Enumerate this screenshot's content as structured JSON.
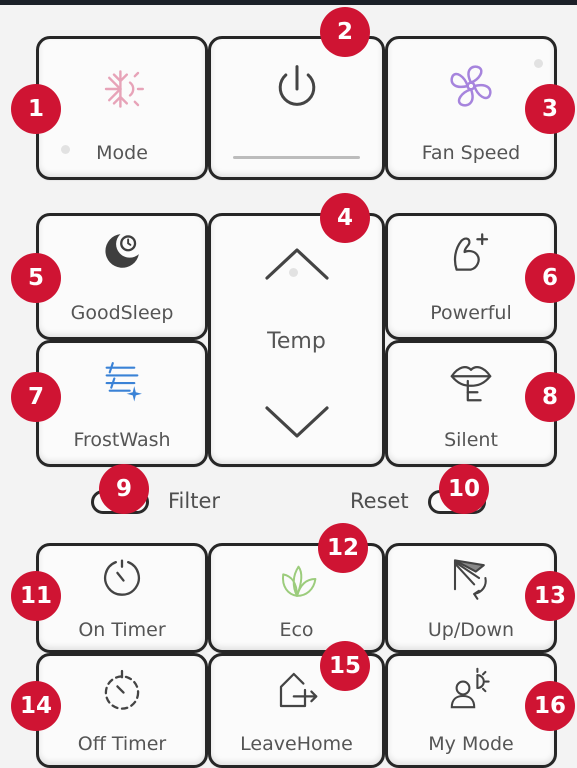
{
  "colors": {
    "badge": "#cf1433",
    "mode_icon": "#e7a3b8",
    "fan_icon": "#a684dd",
    "frostwash_icon": "#3a82d6",
    "eco_icon": "#9ccc7c",
    "outline": "#262626",
    "label_text": "#555555"
  },
  "buttons": {
    "mode": {
      "label": "Mode",
      "icon": "snowflake-sun-icon",
      "badge": "1"
    },
    "power": {
      "icon": "power-icon",
      "badge": "2"
    },
    "fan_speed": {
      "label": "Fan Speed",
      "icon": "fan-icon",
      "badge": "3"
    },
    "temp": {
      "label": "Temp",
      "icon_up": "chevron-up-icon",
      "icon_down": "chevron-down-icon",
      "badge": "4"
    },
    "good_sleep": {
      "label": "GoodSleep",
      "icon": "moon-icon",
      "badge": "5"
    },
    "powerful": {
      "label": "Powerful",
      "icon": "flexed-arm-icon",
      "badge": "6"
    },
    "frost_wash": {
      "label": "FrostWash",
      "icon": "frost-wash-icon",
      "badge": "7"
    },
    "silent": {
      "label": "Silent",
      "icon": "lips-icon",
      "badge": "8"
    },
    "on_timer": {
      "label": "On Timer",
      "icon": "timer-icon",
      "badge": "11"
    },
    "eco": {
      "label": "Eco",
      "icon": "leaves-icon",
      "badge": "12"
    },
    "up_down": {
      "label": "Up/Down",
      "icon": "swing-icon",
      "badge": "13"
    },
    "off_timer": {
      "label": "Off Timer",
      "icon": "dashed-timer-icon",
      "badge": "14"
    },
    "leave_home": {
      "label": "LeaveHome",
      "icon": "leave-home-icon",
      "badge": "15"
    },
    "my_mode": {
      "label": "My Mode",
      "icon": "person-sun-icon",
      "badge": "16"
    }
  },
  "filter": {
    "label": "Filter",
    "badge": "9"
  },
  "reset": {
    "label": "Reset",
    "badge": "10"
  }
}
